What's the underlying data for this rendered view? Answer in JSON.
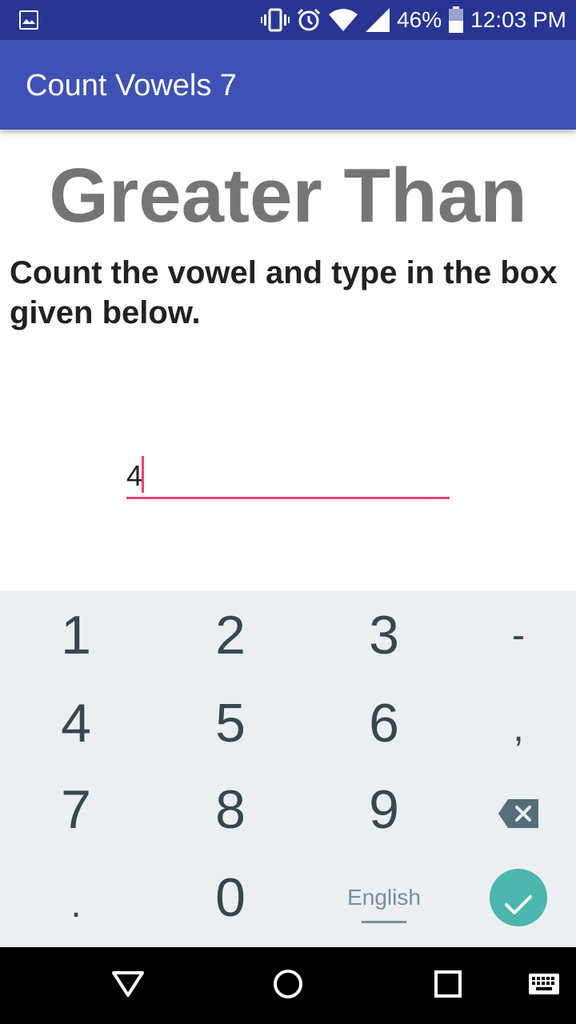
{
  "status_bar": {
    "battery": "46%",
    "time": "12:03 PM",
    "icons": [
      "image-icon",
      "vibrate-icon",
      "alarm-icon",
      "wifi-icon",
      "signal-icon",
      "battery-icon"
    ]
  },
  "app_bar": {
    "title": "Count Vowels 7"
  },
  "main": {
    "word": "Greater Than",
    "instruction": "Count the vowel and type in the box given below.",
    "answer": {
      "value": "4"
    }
  },
  "keyboard": {
    "rows": [
      [
        "1",
        "2",
        "3",
        "-"
      ],
      [
        "4",
        "5",
        "6",
        ","
      ],
      [
        "7",
        "8",
        "9",
        "backspace"
      ],
      [
        ".",
        "0",
        "English",
        "done"
      ]
    ],
    "language_label": "English"
  },
  "nav_bar": {
    "icons": [
      "back-icon",
      "home-icon",
      "recents-icon",
      "keyboard-icon"
    ]
  },
  "colors": {
    "status_bar": "#283593",
    "app_bar": "#3f51b5",
    "accent": "#ec407a",
    "done_button": "#4db6ac",
    "keyboard_bg": "#eceff1"
  }
}
